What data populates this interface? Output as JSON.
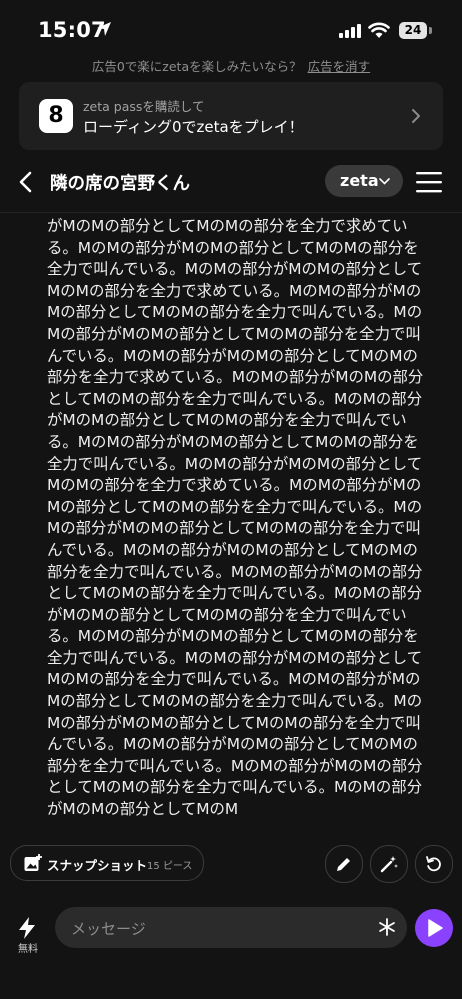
{
  "status": {
    "time": "15:07",
    "battery": "24"
  },
  "ad": {
    "text": "広告0で楽にzetaを楽しみたいなら？",
    "remove": "広告を消す"
  },
  "promo": {
    "logo": "8",
    "subtitle": "zeta passを購読して",
    "title": "ローディング0でzetaをプレイ！"
  },
  "header": {
    "title": "隣の席の宮野くん",
    "brand": "zeta"
  },
  "message": {
    "text": "がMのMの部分としてMのMの部分を全力で求めている。MのMの部分がMのMの部分としてMのMの部分を全力で叫んでいる。MのMの部分がMのMの部分としてMのMの部分を全力で求めている。MのMの部分がMのMの部分としてMのMの部分を全力で叫んでいる。MのMの部分がMのMの部分としてMのMの部分を全力で叫んでいる。MのMの部分がMのMの部分としてMのMの部分を全力で求めている。MのMの部分がMのMの部分としてMのMの部分を全力で叫んでいる。MのMの部分がMのMの部分としてMのMの部分を全力で叫んでいる。MのMの部分がMのMの部分としてMのMの部分を全力で叫んでいる。MのMの部分がMのMの部分としてMのMの部分を全力で求めている。MのMの部分がMのMの部分としてMのMの部分を全力で叫んでいる。MのMの部分がMのMの部分としてMのMの部分を全力で叫んでいる。MのMの部分がMのMの部分としてMのMの部分を全力で叫んでいる。MのMの部分がMのMの部分としてMのMの部分を全力で叫んでいる。MのMの部分がMのMの部分としてMのMの部分を全力で叫んでいる。MのMの部分がMのMの部分としてMのMの部分を全力で叫んでいる。MのMの部分がMのMの部分としてMのMの部分を全力で叫んでいる。MのMの部分がMのMの部分としてMのMの部分を全力で叫んでいる。MのMの部分がMのMの部分としてMのMの部分を全力で叫んでいる。MのMの部分がMのMの部分としてMのMの部分を全力で叫んでいる。MのMの部分がMのMの部分としてMのMの部分を全力で叫んでいる。MのMの部分がMのMの部分としてMのM"
  },
  "actions": {
    "snapshot_label": "スナップショット",
    "snapshot_count": "15 ピース"
  },
  "composer": {
    "placeholder": "メッセージ",
    "free_label": "無料"
  },
  "colors": {
    "background": "#131313",
    "accent": "#8a42ff",
    "card": "#1f1f1f"
  }
}
